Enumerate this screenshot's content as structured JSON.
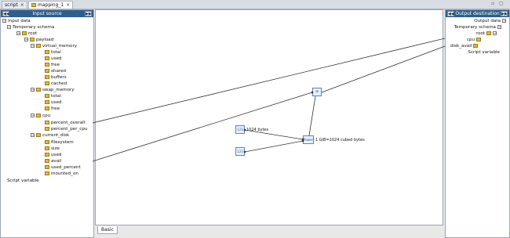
{
  "tabs": [
    {
      "label": "script",
      "close": "×"
    },
    {
      "label": "mapping_1",
      "close": "×"
    }
  ],
  "left_panel": {
    "title": "Input source",
    "btn_left": "◀◀",
    "btn_right": "▶▶",
    "tree": {
      "input_data": "Input data",
      "temporary_schema": "Temporary schema",
      "root": "root",
      "payload": "payload",
      "virtual_memory": "virtual_memory",
      "vm_total": "total",
      "vm_used": "used",
      "vm_free": "free",
      "vm_shared": "shared",
      "vm_buffers": "buffers",
      "vm_cached": "cached",
      "swap_memory": "swap_memory",
      "sw_total": "total",
      "sw_used": "used",
      "sw_free": "free",
      "cpu": "cpu",
      "percent_overall": "percent_overall",
      "percent_per_cpu": "percent_per_cpu",
      "current_disk": "current_disk",
      "filesystem": "filesystem",
      "size": "size",
      "used": "used",
      "avail": "avail",
      "used_percent": "used_percent",
      "mounted_on": "mounted_on",
      "script_variable": "Script variable"
    }
  },
  "right_panel": {
    "title": "Output destination",
    "btn_left": "◀◀",
    "btn_right": "▶▶",
    "tree": {
      "output_data": "Output data",
      "temporary_schema": "Temporary schema",
      "root": "root",
      "cpu": "cpu",
      "disk_avail": "disk_avail",
      "script_variable": "Script variable"
    }
  },
  "canvas": {
    "const_1024": "1024 bytes",
    "expr_label": "1 GiB=1024 cubed bytes",
    "fn_const1": "123",
    "fn_const2": "123",
    "fn_power": "Power",
    "fn_divide": "÷"
  },
  "bottom_tab": "Basic",
  "colors": {
    "header": "#2f5d8c",
    "line": "#333333"
  }
}
